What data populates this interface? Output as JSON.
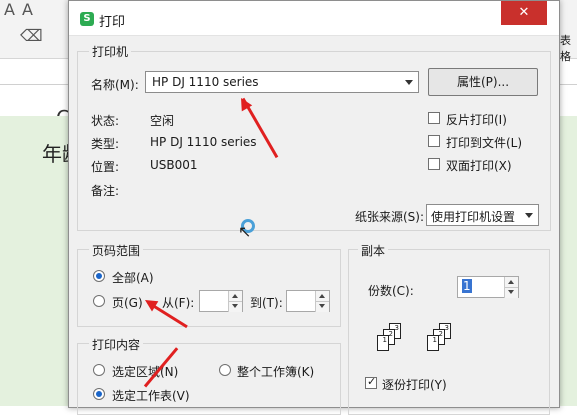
{
  "background": {
    "font_glyph_a": "A",
    "font_glyph_a_up": "A",
    "row_text": "年龄",
    "right_tab": "表格",
    "letter_c": "C"
  },
  "dialog": {
    "title": "打印",
    "app_icon_letter": "S",
    "close_label": "✕",
    "printer": {
      "group_title": "打印机",
      "name_label": "名称(M):",
      "name_value": "HP DJ 1110 series",
      "properties_button": "属性(P)...",
      "status_label": "状态:",
      "status_value": "空闲",
      "type_label": "类型:",
      "type_value": "HP DJ 1110 series",
      "location_label": "位置:",
      "location_value": "USB001",
      "comment_label": "备注:",
      "reverse_print": "反片打印(I)",
      "print_to_file": "打印到文件(L)",
      "duplex_print": "双面打印(X)",
      "paper_source_label": "纸张来源(S):",
      "paper_source_value": "使用打印机设置"
    },
    "page_range": {
      "group_title": "页码范围",
      "all_label": "全部(A)",
      "pages_label": "页(G)",
      "from_label": "从(F):",
      "to_label": "到(T):",
      "selected": "all"
    },
    "copies": {
      "group_title": "副本",
      "count_label": "份数(C):",
      "count_value": "1",
      "collate_label": "逐份打印(Y)",
      "collate_checked": true
    },
    "print_content": {
      "group_title": "打印内容",
      "selected_area": "选定区域(N)",
      "whole_workbook": "整个工作簿(K)",
      "selected_sheet": "选定工作表(V)",
      "selected": "selected_sheet"
    }
  },
  "colors": {
    "annotation_arrow": "#e02020",
    "close_button": "#c9302c",
    "sheet_background": "#e4f1de",
    "app_icon": "#2dab52"
  }
}
